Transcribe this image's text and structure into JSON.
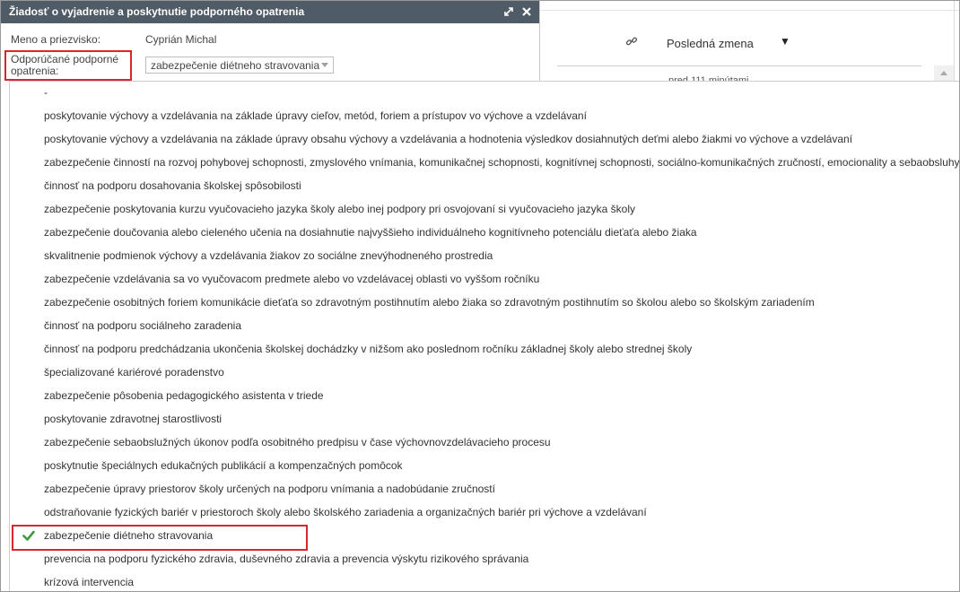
{
  "background": {
    "column_title": "Posledná zmena",
    "peek_text": "pred 111 minútami"
  },
  "dialog": {
    "title": "Žiadosť o vyjadrenie a poskytnutie podporného opatrenia",
    "name_label": "Meno a priezvisko:",
    "name_value": "Cyprián Michal",
    "measures_label_line1": "Odporúčané podporné",
    "measures_label_line2": "opatrenia:",
    "selected_value": "zabezpečenie diétneho stravovania"
  },
  "dropdown": {
    "items": [
      "-",
      "poskytovanie výchovy a vzdelávania na základe úpravy cieľov, metód, foriem a prístupov vo výchove a vzdelávaní",
      "poskytovanie výchovy a vzdelávania na základe úpravy obsahu výchovy a vzdelávania a hodnotenia výsledkov dosiahnutých deťmi alebo žiakmi vo výchove a vzdelávaní",
      "zabezpečenie činností na rozvoj pohybovej schopnosti, zmyslového vnímania, komunikačnej schopnosti, kognitívnej schopnosti, sociálno-komunikačných zručností, emocionality a sebaobsluhy",
      "činnosť na podporu dosahovania školskej spôsobilosti",
      "zabezpečenie poskytovania kurzu vyučovacieho jazyka školy alebo inej podpory pri osvojovaní si vyučovacieho jazyka školy",
      "zabezpečenie doučovania alebo cieleného učenia na dosiahnutie najvyššieho individuálneho kognitívneho potenciálu dieťaťa alebo žiaka",
      "skvalitnenie podmienok výchovy a vzdelávania žiakov zo sociálne znevýhodneného prostredia",
      "zabezpečenie vzdelávania sa vo vyučovacom predmete alebo vo vzdelávacej oblasti vo vyššom ročníku",
      "zabezpečenie osobitných foriem komunikácie dieťaťa so zdravotným postihnutím alebo žiaka so zdravotným postihnutím so školou alebo so školským zariadením",
      "činnosť na podporu sociálneho zaradenia",
      "činnosť na podporu predchádzania ukončenia školskej dochádzky v nižšom ako poslednom ročníku základnej školy alebo strednej školy",
      "špecializované kariérové poradenstvo",
      "zabezpečenie pôsobenia pedagogického asistenta v triede",
      "poskytovanie zdravotnej starostlivosti",
      "zabezpečenie sebaobslužných úkonov podľa osobitného predpisu v čase výchovnovzdelávacieho procesu",
      "poskytnutie špeciálnych edukačných publikácií a kompenzačných pomôcok",
      "zabezpečenie úpravy priestorov školy určených na podporu vnímania a nadobúdanie zručností",
      "odstraňovanie fyzických bariér v priestoroch školy alebo školského zariadenia a organizačných bariér pri výchove a vzdelávaní",
      "zabezpečenie diétneho stravovania",
      "prevencia na podporu fyzického zdravia, duševného zdravia a prevencia výskytu rizikového správania",
      "krízová intervencia"
    ],
    "selected_index": 19
  },
  "colors": {
    "titlebar": "#4f5b66",
    "highlight": "#d9272e",
    "check": "#3f9a3a"
  }
}
